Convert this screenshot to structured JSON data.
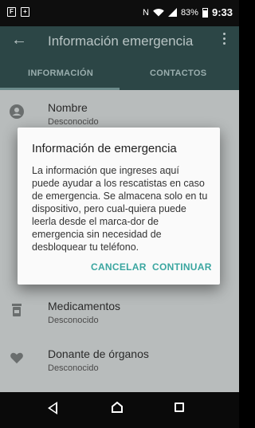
{
  "status_bar": {
    "notification_icons": [
      "F",
      "+"
    ],
    "battery_percent": "83%",
    "time": "9:33"
  },
  "app_bar": {
    "title": "Información emergencia"
  },
  "tabs": [
    {
      "label": "INFORMACIÓN",
      "selected": true
    },
    {
      "label": "CONTACTOS",
      "selected": false
    }
  ],
  "list": {
    "items": [
      {
        "label": "Nombre",
        "value": "Desconocido",
        "icon": "person-icon"
      },
      {
        "label": "Medicamentos",
        "value": "Desconocido",
        "icon": "medication-icon"
      },
      {
        "label": "Donante de órganos",
        "value": "Desconocido",
        "icon": "heart-icon"
      }
    ]
  },
  "dialog": {
    "title": "Información de emergencia",
    "body": "La información que ingreses aquí puede ayudar a los rescatistas en caso de emergencia. Se almacena solo en tu dispositivo, pero cual-quiera puede leerla desde el marca-dor de emergencia sin necesidad de desbloquear tu teléfono.",
    "cancel_label": "CANCELAR",
    "continue_label": "CONTINUAR"
  },
  "colors": {
    "accent": "#3aa6a0",
    "app_bar_dimmed": "#2c4646",
    "list_dimmed": "#b8bcbc"
  }
}
